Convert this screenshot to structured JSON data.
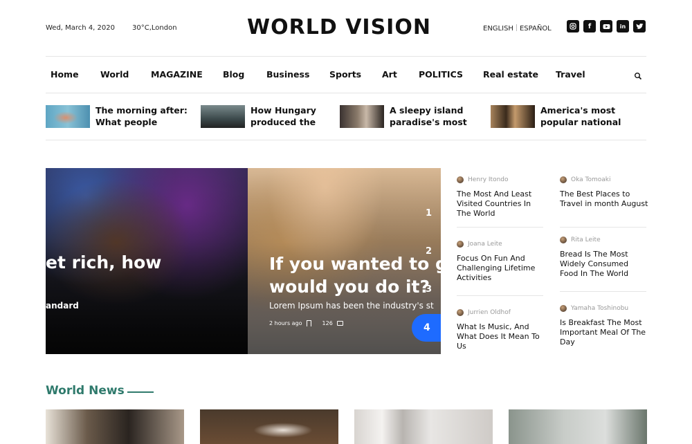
{
  "header": {
    "date": "Wed, March 4, 2020",
    "weather": "30°C,London",
    "logo": "WORLD VISION",
    "languages": [
      "ENGLISH",
      "ESPAÑOL"
    ],
    "social_icons": [
      "instagram-icon",
      "facebook-icon",
      "youtube-icon",
      "linkedin-icon",
      "twitter-icon"
    ]
  },
  "nav": {
    "items": [
      "Home",
      "World",
      "MAGAZINE",
      "Blog",
      "Business",
      "Sports",
      "Art",
      "POLITICS",
      "Real estate",
      "Travel"
    ]
  },
  "trending": [
    {
      "line1": "The morning after:",
      "line2": "What people"
    },
    {
      "line1": "How Hungary",
      "line2": "produced the"
    },
    {
      "line1": "A sleepy island",
      "line2": "paradise's most"
    },
    {
      "line1": "America's most",
      "line2": "popular national"
    }
  ],
  "hero": {
    "left_title": "et rich, how",
    "left_sub": "andard",
    "title_line1": "If you wanted to ge",
    "title_line2": "would you do it?",
    "subtitle": "Lorem Ipsum has been the industry's st",
    "time": "2 hours ago",
    "comments": "126",
    "pages": [
      "1",
      "2",
      "3",
      "4"
    ],
    "active_page": "4",
    "accent_color": "#1e6bff"
  },
  "side_articles": [
    {
      "author": "Henry Itondo",
      "title": "The Most And Least Visited Countries In The World"
    },
    {
      "author": "Oka Tomoaki",
      "title": "The Best Places to Travel in month August"
    },
    {
      "author": "Joana Leite",
      "title": "Focus On Fun And Challenging Lifetime Activities"
    },
    {
      "author": "Rita Leite",
      "title": "Bread Is The Most Widely Consumed Food In The World"
    },
    {
      "author": "Jurrien Oldhof",
      "title": "What Is Music, And What Does It Mean To Us"
    },
    {
      "author": "Yamaha Toshinobu",
      "title": "Is Breakfast The Most Important Meal Of The Day"
    }
  ],
  "world_news": {
    "title": "World News",
    "accent_color": "#2f7a6c"
  }
}
